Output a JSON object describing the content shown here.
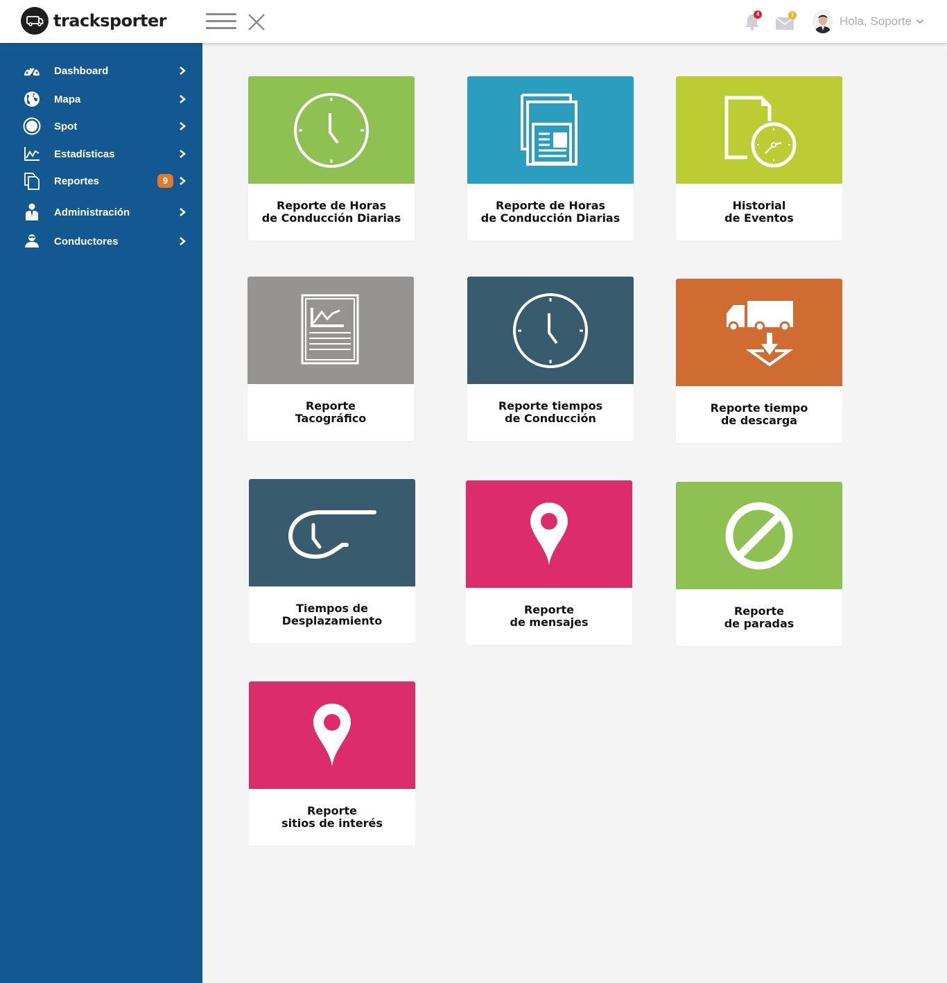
{
  "header": {
    "brand": "tracksporter",
    "greeting": "Hola, Soporte",
    "notifications_count": "4",
    "messages_count": "1",
    "avatar_icon": "user-avatar"
  },
  "sidebar": {
    "background": "#145891",
    "items": [
      {
        "label": "Dashboard",
        "icon": "dashboard-gauge-icon"
      },
      {
        "label": "Mapa",
        "icon": "globe-icon"
      },
      {
        "label": "Spot",
        "icon": "spot-circle-icon"
      },
      {
        "label": "Estadísticas",
        "icon": "chart-line-icon"
      },
      {
        "label": "Reportes",
        "icon": "documents-icon",
        "badge": "9"
      },
      {
        "label": "Administración",
        "icon": "admin-user-icon"
      },
      {
        "label": "Conductores",
        "icon": "drivers-icon"
      }
    ]
  },
  "cards": [
    {
      "title": "Reporte de Horas\nde Conducción Diarias",
      "color": "#8fc052",
      "icon": "clock-icon"
    },
    {
      "title": "Reporte de Horas\nde Conducción Diarias",
      "color": "#2b9dbf",
      "icon": "documents-icon"
    },
    {
      "title": "Historial\nde Eventos",
      "color": "#bccc33",
      "icon": "file-clock-icon"
    },
    {
      "title": "Reporte\nTacográfico",
      "color": "#959492",
      "icon": "report-chart-icon"
    },
    {
      "title": "Reporte tiempos\nde Conducción",
      "color": "#385b6d",
      "icon": "clock-icon"
    },
    {
      "title": "Reporte tiempo\nde descarga",
      "color": "#d06b32",
      "icon": "truck-download-icon"
    },
    {
      "title": "Tiempos de\nDesplazamiento",
      "color": "#385b6d",
      "icon": "travel-time-icon"
    },
    {
      "title": "Reporte\nde mensajes",
      "color": "#dc2c69",
      "icon": "map-pin-icon"
    },
    {
      "title": "Reporte\nde paradas",
      "color": "#8fc052",
      "icon": "no-entry-icon"
    },
    {
      "title": "Reporte\nsitios de interés",
      "color": "#dc2c69",
      "icon": "map-pin-icon"
    }
  ]
}
